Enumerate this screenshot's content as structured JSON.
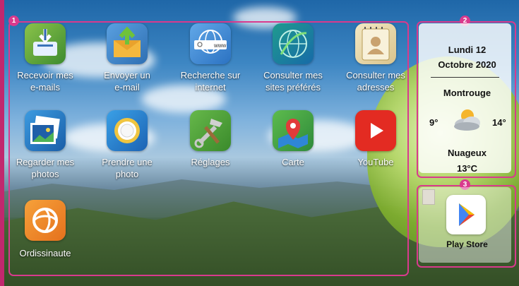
{
  "callouts": {
    "one": "1",
    "two": "2",
    "three": "3"
  },
  "apps": [
    {
      "line1": "Recevoir mes",
      "line2": "e-mails",
      "icon": "inbox-download-icon"
    },
    {
      "line1": "Envoyer un",
      "line2": "e-mail",
      "icon": "send-mail-icon"
    },
    {
      "line1": "Recherche sur",
      "line2": "internet",
      "icon": "web-search-icon"
    },
    {
      "line1": "Consulter mes",
      "line2": "sites préférés",
      "icon": "favorite-sites-icon"
    },
    {
      "line1": "Consulter mes",
      "line2": "adresses",
      "icon": "address-book-icon"
    },
    {
      "line1": "Regarder mes",
      "line2": "photos",
      "icon": "photo-gallery-icon"
    },
    {
      "line1": "Prendre une",
      "line2": "photo",
      "icon": "camera-icon"
    },
    {
      "line1": "Réglages",
      "line2": "",
      "icon": "settings-tools-icon"
    },
    {
      "line1": "Carte",
      "line2": "",
      "icon": "map-pin-icon"
    },
    {
      "line1": "YouTube",
      "line2": "",
      "icon": "youtube-play-icon"
    },
    {
      "line1": "Ordissinaute",
      "line2": "",
      "icon": "ordissinaute-logo-icon"
    }
  ],
  "weather": {
    "day": "Lundi 12",
    "date": "Octobre 2020",
    "city": "Montrouge",
    "min": "9°",
    "max": "14°",
    "condition": "Nuageux",
    "temp": "13°C",
    "icon": "partly-cloudy-icon"
  },
  "playstore": {
    "label": "Play Store",
    "icon": "play-store-icon"
  }
}
